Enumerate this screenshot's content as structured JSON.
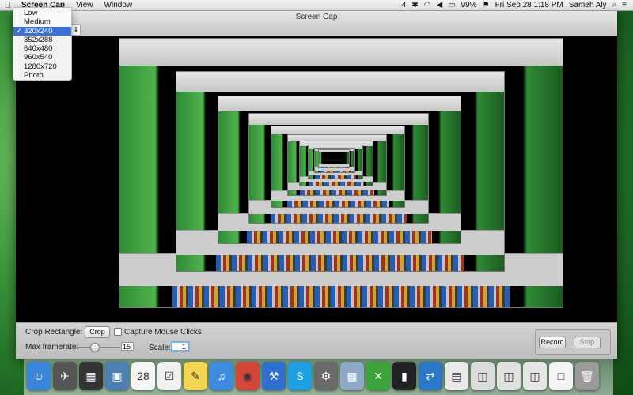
{
  "menubar": {
    "app_name": "Screen Cap",
    "items": [
      "View",
      "Window"
    ],
    "status": {
      "battery": "99%",
      "datetime": "Fri Sep 28  1:18 PM",
      "user": "Sameh Aly",
      "counter": "4"
    }
  },
  "window": {
    "title": "Screen Cap"
  },
  "quality_menu": {
    "options": [
      "Low",
      "Medium",
      "320x240",
      "352x288",
      "640x480",
      "960x540",
      "1280x720",
      "Photo"
    ],
    "selected_index": 2,
    "check_mark": "✓"
  },
  "controls": {
    "crop_label": "Crop Rectangle:",
    "crop_button": "Crop",
    "capture_label": "Capture Mouse Clicks",
    "capture_checked": false,
    "framerate_label": "Max framerate:",
    "framerate_value": "15",
    "framerate_level": 0.45,
    "scale_label": "Scale:",
    "scale_value": "1",
    "record_button": "Record",
    "stop_button": "Stop"
  },
  "dock": {
    "items": [
      {
        "icon": "finder-icon",
        "color": "#3a86d8",
        "glyph": "☺"
      },
      {
        "icon": "launchpad-icon",
        "color": "#555555",
        "glyph": "✈"
      },
      {
        "icon": "mission-control-icon",
        "color": "#333333",
        "glyph": "▦"
      },
      {
        "icon": "preview-icon",
        "color": "#4d7fb3",
        "glyph": "▣"
      },
      {
        "icon": "calendar-icon",
        "color": "#f5f5f5",
        "glyph": "28"
      },
      {
        "icon": "reminders-icon",
        "color": "#f0f0f0",
        "glyph": "☑"
      },
      {
        "icon": "stickies-icon",
        "color": "#f2d552",
        "glyph": "✎"
      },
      {
        "icon": "itunes-icon",
        "color": "#3f8be0",
        "glyph": "♫"
      },
      {
        "icon": "chrome-icon",
        "color": "#d44637",
        "glyph": "◉"
      },
      {
        "icon": "xcode-icon",
        "color": "#2f6fcf",
        "glyph": "⚒"
      },
      {
        "icon": "skype-icon",
        "color": "#1ea1e2",
        "glyph": "S"
      },
      {
        "icon": "network-utility-icon",
        "color": "#6a6a6a",
        "glyph": "⚙"
      },
      {
        "icon": "photo-browser-icon",
        "color": "#8fa9c9",
        "glyph": "▩"
      },
      {
        "icon": "x-app-icon",
        "color": "#3aa63a",
        "glyph": "✕"
      },
      {
        "icon": "terminal-icon",
        "color": "#222222",
        "glyph": "▮"
      },
      {
        "icon": "network-icon",
        "color": "#2c78c8",
        "glyph": "⇄"
      },
      {
        "icon": "documents-icon",
        "color": "#e9e9e9",
        "glyph": "▤"
      },
      {
        "icon": "chrome-window-icon",
        "color": "#dcdcdc",
        "glyph": "◫"
      },
      {
        "icon": "window-thumbnail-icon",
        "color": "#e0e0e0",
        "glyph": "◫"
      },
      {
        "icon": "window-thumbnail-icon",
        "color": "#e6e6e6",
        "glyph": "◫"
      },
      {
        "icon": "window-thumbnail-icon",
        "color": "#f4f4f4",
        "glyph": "□"
      },
      {
        "icon": "trash-icon",
        "color": "#9a9a9a",
        "glyph": "🗑"
      }
    ]
  }
}
